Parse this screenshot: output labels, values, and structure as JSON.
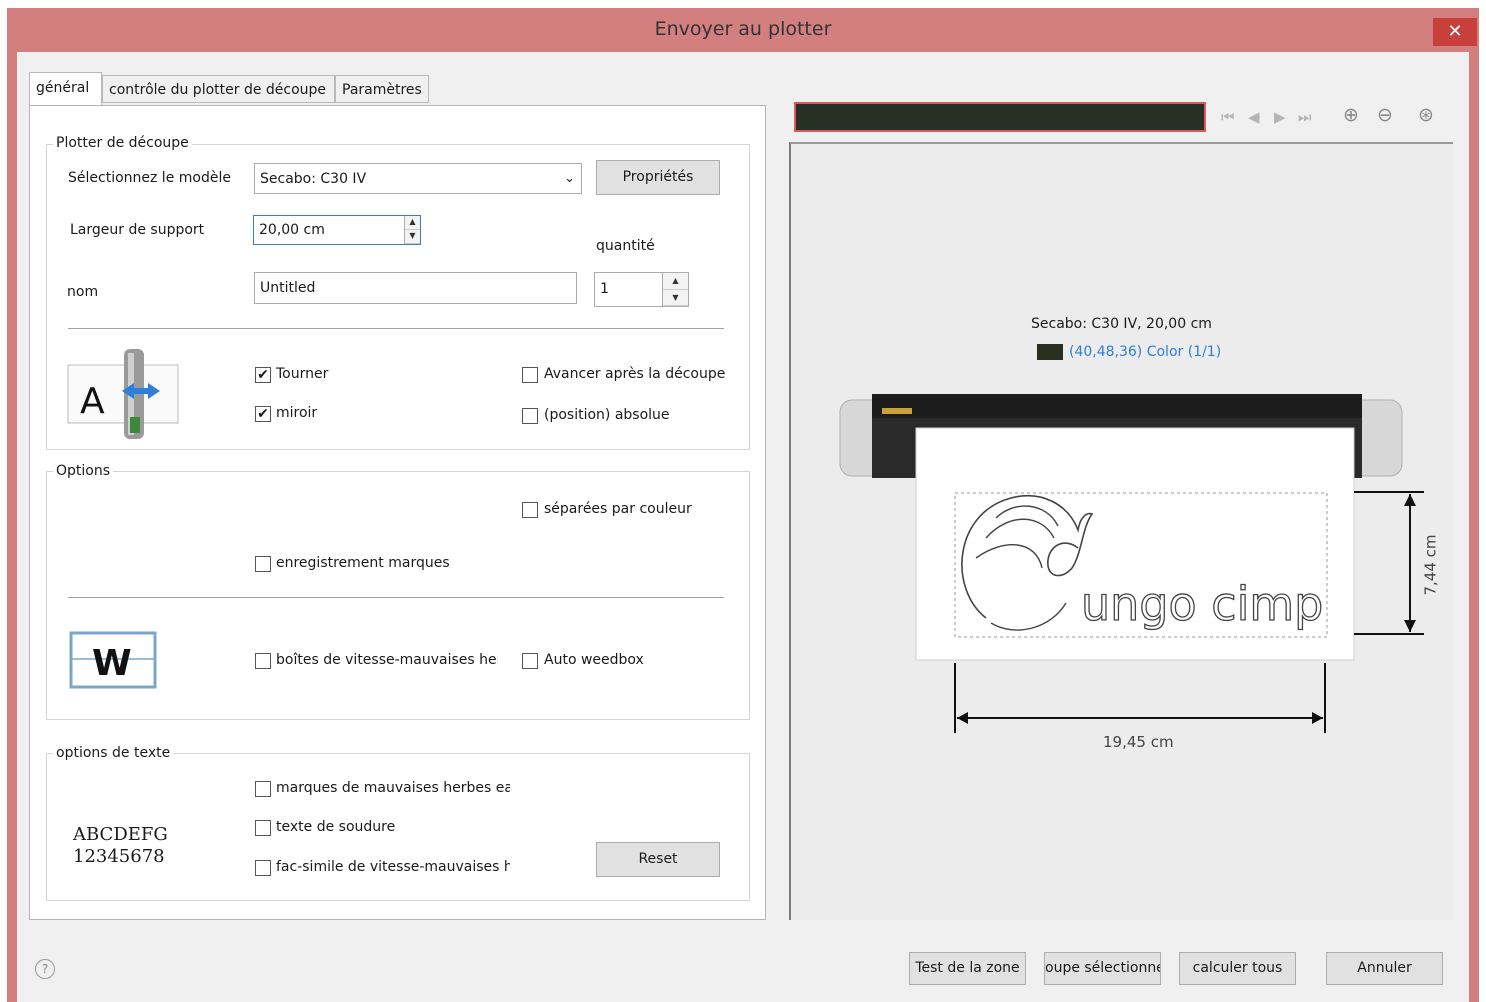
{
  "window": {
    "title": "Envoyer au plotter",
    "close_glyph": "✕"
  },
  "tabs": [
    {
      "label": "général"
    },
    {
      "label": "contrôle du plotter de découpe"
    },
    {
      "label": "Paramètres"
    }
  ],
  "plotter_group": {
    "title": "Plotter de découpe",
    "model_label": "Sélectionnez le modèle",
    "model_value": "Secabo: C30 IV",
    "properties_button": "Propriétés",
    "width_label": "Largeur de support",
    "width_value": "20,00 cm",
    "quantity_label": "quantité",
    "quantity_value": "1",
    "name_label": "nom",
    "name_value": "Untitled",
    "rotate_label": "Tourner",
    "rotate_checked": true,
    "mirror_label": "miroir",
    "mirror_checked": true,
    "advance_label": "Avancer après la découpe",
    "advance_checked": false,
    "absolute_label": "(position) absolue",
    "absolute_checked": false,
    "icon_letter": "A"
  },
  "options_group": {
    "title": "Options",
    "color_separate_label": "séparées par couleur",
    "registration_label": "enregistrement marques",
    "weedbox_label": "boîtes de vitesse-mauvaises her",
    "auto_weedbox_label": "Auto weedbox",
    "icon_letter": "W"
  },
  "text_group": {
    "title": "options de texte",
    "weed_marks_label": "marques de mauvaises herbes ea:",
    "weld_text_label": "texte de soudure",
    "facsimile_label": "fac-simile de vitesse-mauvaises h",
    "sample_line1": "ABCDEFG",
    "sample_line2": "12345678",
    "reset_button": "Reset"
  },
  "preview": {
    "device_info": "Secabo: C30 IV,  20,00 cm",
    "color_info": "(40,48,36) Color (1/1)",
    "swatch_color": "#28301f",
    "width_dim": "19,45 cm",
    "height_dim": "7,44 cm",
    "design_text": "ungo cimp"
  },
  "footer": {
    "help_glyph": "?",
    "test_zone_button": "Test de la zone",
    "cut_selected_button": "oupe sélectionne",
    "calculate_all_button": "calculer tous",
    "cancel_button": "Annuler"
  },
  "colors": {
    "titlebar": "#d47f7f",
    "close": "#c7403b",
    "link": "#2f7fd8"
  }
}
